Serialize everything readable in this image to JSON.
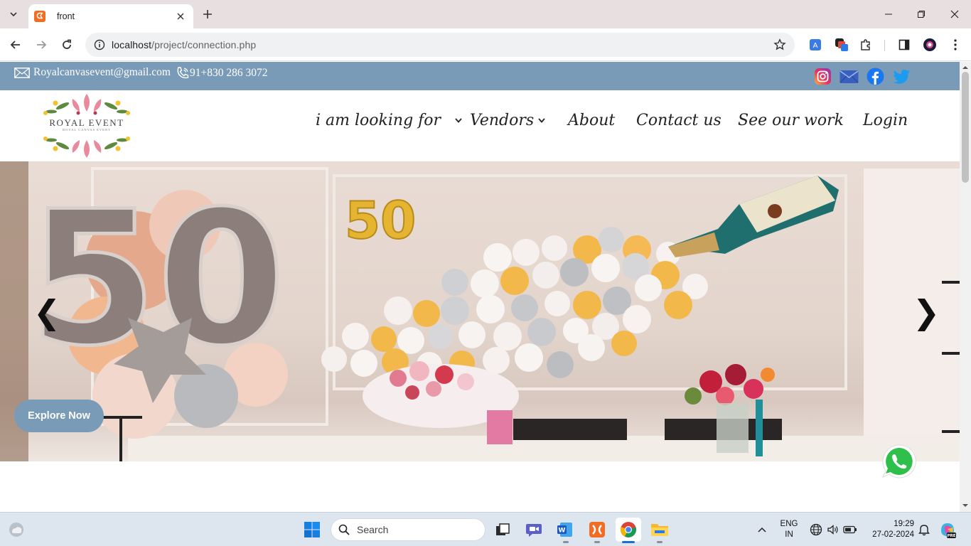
{
  "browser": {
    "tab_title": "front",
    "url_host": "localhost",
    "url_path": "/project/connection.php"
  },
  "topbar": {
    "email": "Royalcanvasevent@gmail.com",
    "phone": "91+830 286 3072",
    "bg_color": "#7a9bb8"
  },
  "logo": {
    "title": "ROYAL EVENT",
    "subtitle": "ROYAL CANVAS EVENT"
  },
  "nav": {
    "looking_for": "i am looking for",
    "vendors": "Vendors",
    "about": "About",
    "contact": "Contact us",
    "work": "See our work",
    "login": "Login"
  },
  "hero": {
    "prev_arrow": "❮",
    "next_arrow": "❯",
    "explore_label": "Explore Now",
    "balloon_number": "50",
    "small_number": "50"
  },
  "taskbar": {
    "search_label": "Search",
    "lang_top": "ENG",
    "lang_bottom": "IN",
    "time": "19:29",
    "date": "27-02-2024"
  }
}
